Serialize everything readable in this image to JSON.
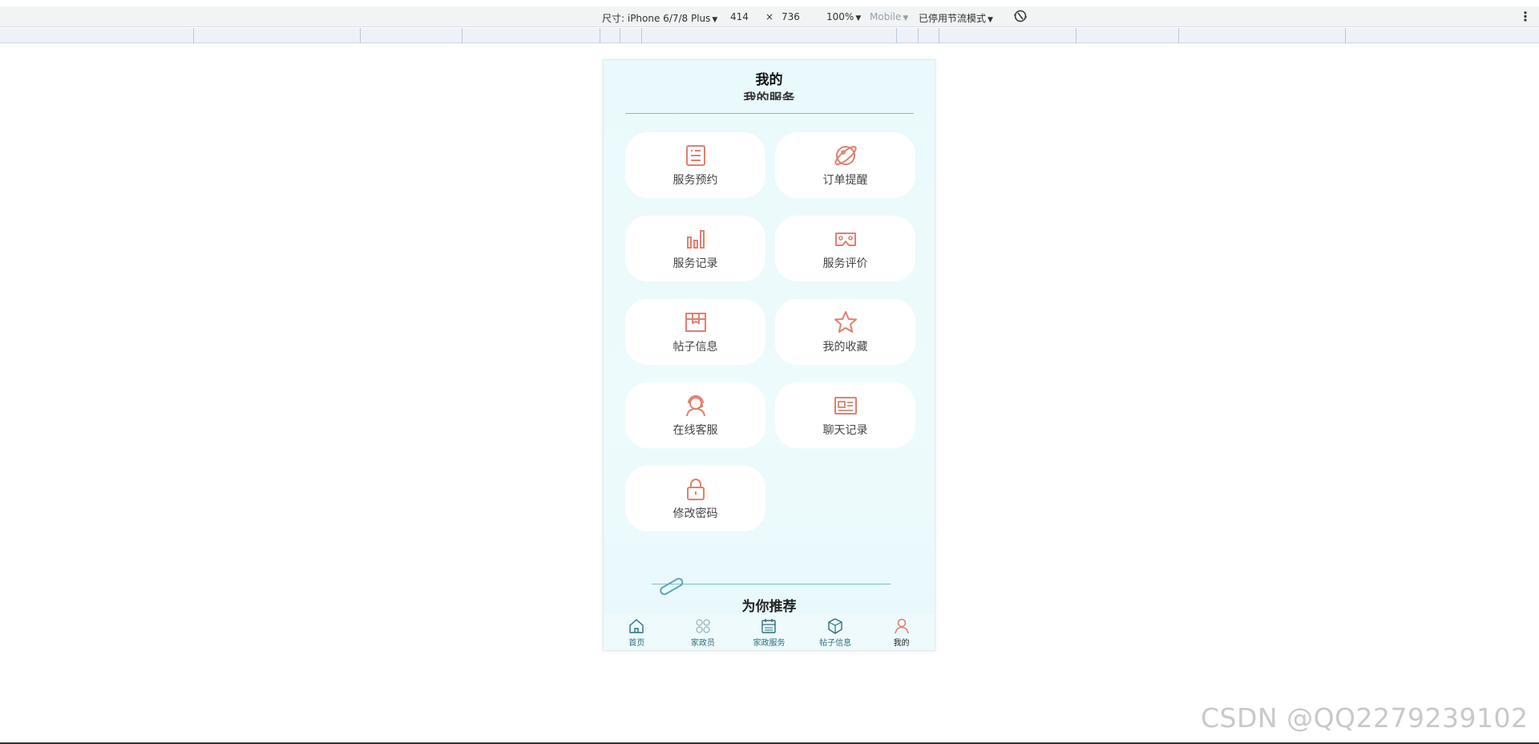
{
  "devtools": {
    "size_label": "尺寸: iPhone 6/7/8 Plus",
    "width": "414",
    "times": "×",
    "height": "736",
    "zoom": "100%",
    "mode": "Mobile",
    "throttle": "已停用节流模式"
  },
  "page": {
    "title": "我的",
    "section_title": "我的服务",
    "recommend_title": "为你推荐"
  },
  "services": [
    {
      "label": "服务预约",
      "icon": "appointment-icon"
    },
    {
      "label": "订单提醒",
      "icon": "planet-icon"
    },
    {
      "label": "服务记录",
      "icon": "bar-chart-icon"
    },
    {
      "label": "服务评价",
      "icon": "vr-glasses-icon"
    },
    {
      "label": "帖子信息",
      "icon": "package-icon"
    },
    {
      "label": "我的收藏",
      "icon": "star-icon"
    },
    {
      "label": "在线客服",
      "icon": "customer-service-icon"
    },
    {
      "label": "聊天记录",
      "icon": "id-card-icon"
    },
    {
      "label": "修改密码",
      "icon": "lock-icon"
    }
  ],
  "tabs": [
    {
      "label": "首页",
      "icon": "home-icon"
    },
    {
      "label": "家政员",
      "icon": "grid-icon"
    },
    {
      "label": "家政服务",
      "icon": "calendar-icon"
    },
    {
      "label": "帖子信息",
      "icon": "box-icon"
    },
    {
      "label": "我的",
      "icon": "user-icon"
    }
  ],
  "watermark": "CSDN @QQ2279239102",
  "colors": {
    "accent": "#e0806e",
    "teal": "#2c6f7d",
    "divider": "#76c2cf",
    "background": "#eaf9fb"
  }
}
